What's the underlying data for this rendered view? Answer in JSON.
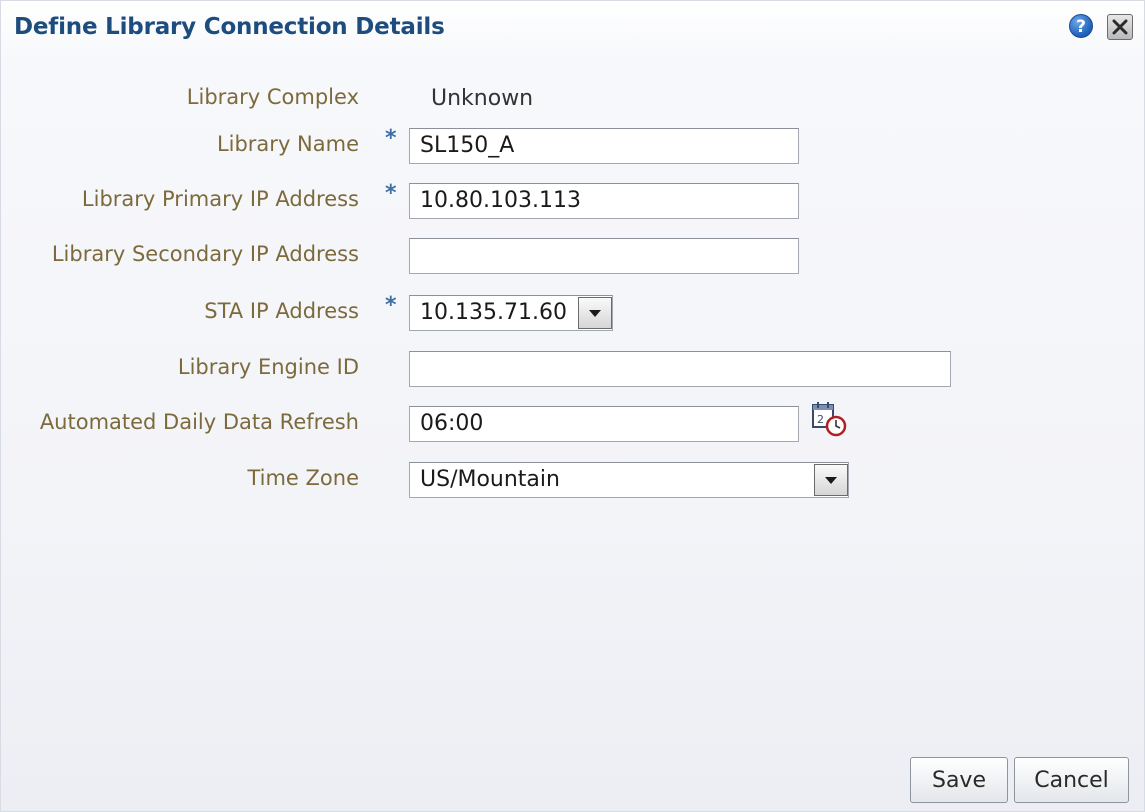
{
  "dialog": {
    "title": "Define Library Connection Details",
    "help_icon": "?",
    "close_icon": "close-icon"
  },
  "form": {
    "library_complex": {
      "label": "Library Complex",
      "value": "Unknown"
    },
    "library_name": {
      "label": "Library Name",
      "required": "*",
      "value": "SL150_A"
    },
    "primary_ip": {
      "label": "Library Primary IP Address",
      "required": "*",
      "value": "10.80.103.113"
    },
    "secondary_ip": {
      "label": "Library Secondary IP Address",
      "value": ""
    },
    "sta_ip": {
      "label": "STA IP Address",
      "required": "*",
      "value": "10.135.71.60"
    },
    "engine_id": {
      "label": "Library Engine ID",
      "value": ""
    },
    "daily_refresh": {
      "label": "Automated Daily Data Refresh",
      "value": "06:00"
    },
    "time_zone": {
      "label": "Time Zone",
      "value": "US/Mountain"
    }
  },
  "buttons": {
    "save": "Save",
    "cancel": "Cancel"
  },
  "colors": {
    "title": "#1d4d7e",
    "label": "#7d6a3c",
    "required": "#3f6fa6"
  }
}
